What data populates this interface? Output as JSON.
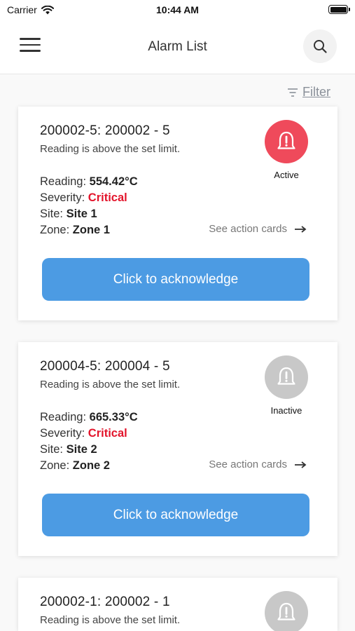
{
  "status_bar": {
    "carrier": "Carrier",
    "time": "10:44 AM"
  },
  "header": {
    "title": "Alarm List"
  },
  "filter": {
    "label": "Filter"
  },
  "labels": {
    "reading": "Reading:",
    "severity": "Severity:",
    "site": "Site:",
    "zone": "Zone:"
  },
  "alarms": [
    {
      "title": "200002-5: 200002 - 5",
      "description": "Reading is above the set limit.",
      "reading": "554.42°C",
      "severity": "Critical",
      "site": "Site 1",
      "zone": "Zone 1",
      "state": "Active",
      "action_link": "See action cards",
      "ack_label": "Click to acknowledge"
    },
    {
      "title": "200004-5: 200004 - 5",
      "description": "Reading is above the set limit.",
      "reading": "665.33°C",
      "severity": "Critical",
      "site": "Site 2",
      "zone": "Zone 2",
      "state": "Inactive",
      "action_link": "See action cards",
      "ack_label": "Click to acknowledge"
    },
    {
      "title": "200002-1: 200002 - 1",
      "description": "Reading is above the set limit.",
      "state": "Inactive"
    }
  ],
  "colors": {
    "active_bell": "#ef4a5b",
    "inactive_bell": "#c8c8c8",
    "ack_button": "#4c9be3",
    "critical": "#e3142b"
  }
}
